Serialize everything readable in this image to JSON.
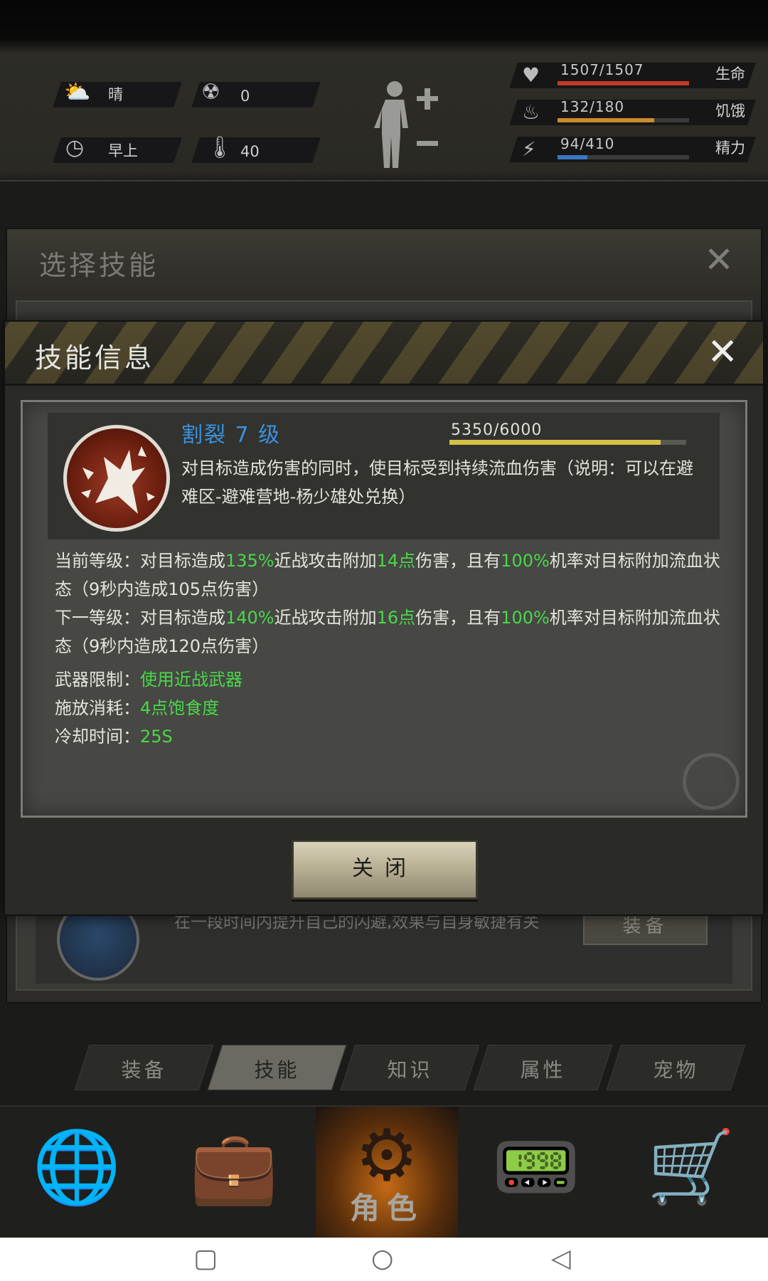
{
  "status": {
    "weather": {
      "icon": "cloud-sun-icon",
      "text": "晴"
    },
    "radiation": {
      "icon": "radiation-icon",
      "value": "0"
    },
    "time_of_day": {
      "icon": "clock-icon",
      "text": "早上"
    },
    "temperature": {
      "icon": "thermometer-icon",
      "value": "40"
    },
    "stats": [
      {
        "name": "health",
        "icon": "heart-icon",
        "value": "1507/1507",
        "label": "生命",
        "current": 1507,
        "max": 1507,
        "color": "#c0392b"
      },
      {
        "name": "hunger",
        "icon": "stomach-icon",
        "value": "132/180",
        "label": "饥饿",
        "current": 132,
        "max": 180,
        "color": "#c98b2b"
      },
      {
        "name": "energy",
        "icon": "lightning-icon",
        "value": "94/410",
        "label": "精力",
        "current": 94,
        "max": 410,
        "color": "#3b76c4"
      }
    ]
  },
  "select_skill_panel": {
    "title": "选择技能",
    "bg_item": {
      "description": "在一段时间内提升自己的闪避,效果与自身敏捷有关",
      "equip_label": "装备"
    }
  },
  "skill_info": {
    "title": "技能信息",
    "skill_name": "割裂 7 级",
    "exp_text": "5350/6000",
    "exp_current": 5350,
    "exp_max": 6000,
    "description": "对目标造成伤害的同时，使目标受到持续流血伤害（说明：可以在避难区-避难营地-杨少雄处兑换）",
    "current_level": {
      "p1": "当前等级：对目标造成",
      "v1": "135%",
      "p2": "近战攻击附加",
      "v2": "14点",
      "p3": "伤害，且有",
      "v3": "100%",
      "p4": "机率对目标附加流血状态（9秒内造成105点伤害）"
    },
    "next_level": {
      "p1": "下一等级：对目标造成",
      "v1": "140%",
      "p2": "近战攻击附加",
      "v2": "16点",
      "p3": "伤害，且有",
      "v3": "100%",
      "p4": "机率对目标附加流血状态（9秒内造成120点伤害）"
    },
    "weapon_limit": {
      "label": "武器限制：",
      "value": "使用近战武器"
    },
    "cast_cost": {
      "label": "施放消耗：",
      "value": "4点饱食度"
    },
    "cooldown": {
      "label": "冷却时间：",
      "value": "25S"
    },
    "close_label": "关闭"
  },
  "tabs": [
    {
      "label": "装备",
      "active": false
    },
    {
      "label": "技能",
      "active": true
    },
    {
      "label": "知识",
      "active": false
    },
    {
      "label": "属性",
      "active": false
    },
    {
      "label": "宠物",
      "active": false
    }
  ],
  "bottom_nav": [
    {
      "icon": "globe-icon",
      "label": ""
    },
    {
      "icon": "backpack-icon",
      "label": ""
    },
    {
      "icon": "character-head-icon",
      "label": "角色",
      "active": true
    },
    {
      "icon": "radio-icon",
      "label": ""
    },
    {
      "icon": "cart-icon",
      "label": ""
    }
  ],
  "android_nav": {
    "recent": "recent-apps-icon",
    "home": "home-icon",
    "back": "back-icon"
  }
}
